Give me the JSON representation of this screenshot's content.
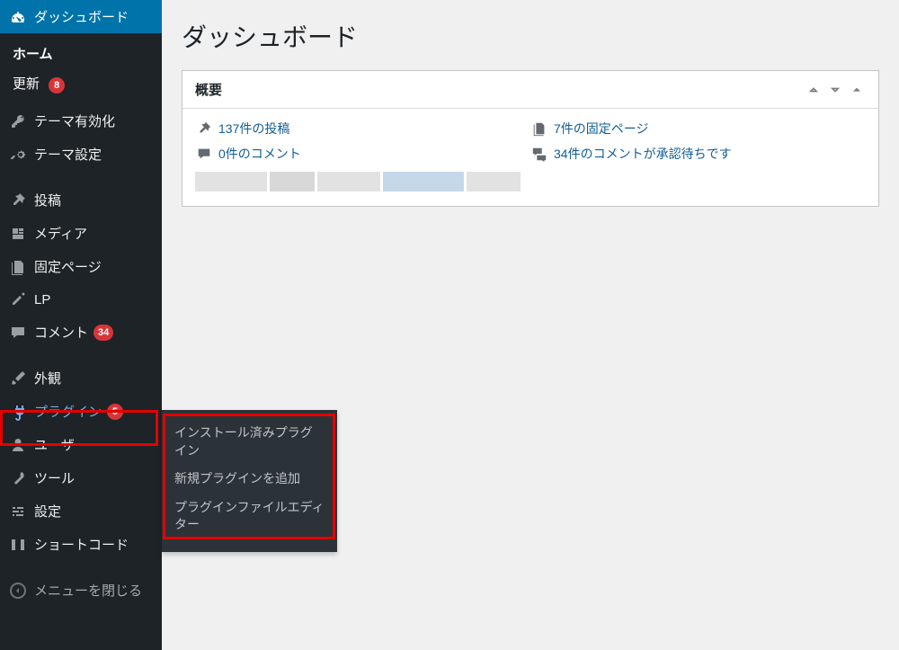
{
  "sidebar": {
    "dashboard": "ダッシュボード",
    "home": "ホーム",
    "updates": "更新",
    "updates_badge": "8",
    "theme_activate": "テーマ有効化",
    "theme_settings": "テーマ設定",
    "posts": "投稿",
    "media": "メディア",
    "pages": "固定ページ",
    "lp": "LP",
    "comments": "コメント",
    "comments_badge": "34",
    "appearance": "外観",
    "plugins": "プラグイン",
    "plugins_badge": "5",
    "users": "ユーザー",
    "tools": "ツール",
    "settings": "設定",
    "shortcode": "ショートコード",
    "collapse": "メニューを閉じる"
  },
  "flyout": {
    "installed": "インストール済みプラグイン",
    "add_new": "新規プラグインを追加",
    "editor": "プラグインファイルエディター"
  },
  "main": {
    "title": "ダッシュボード",
    "overview": {
      "title": "概要",
      "posts": "137件の投稿",
      "pages": "7件の固定ページ",
      "comments": "0件のコメント",
      "pending": "34件のコメントが承認待ちです"
    }
  }
}
